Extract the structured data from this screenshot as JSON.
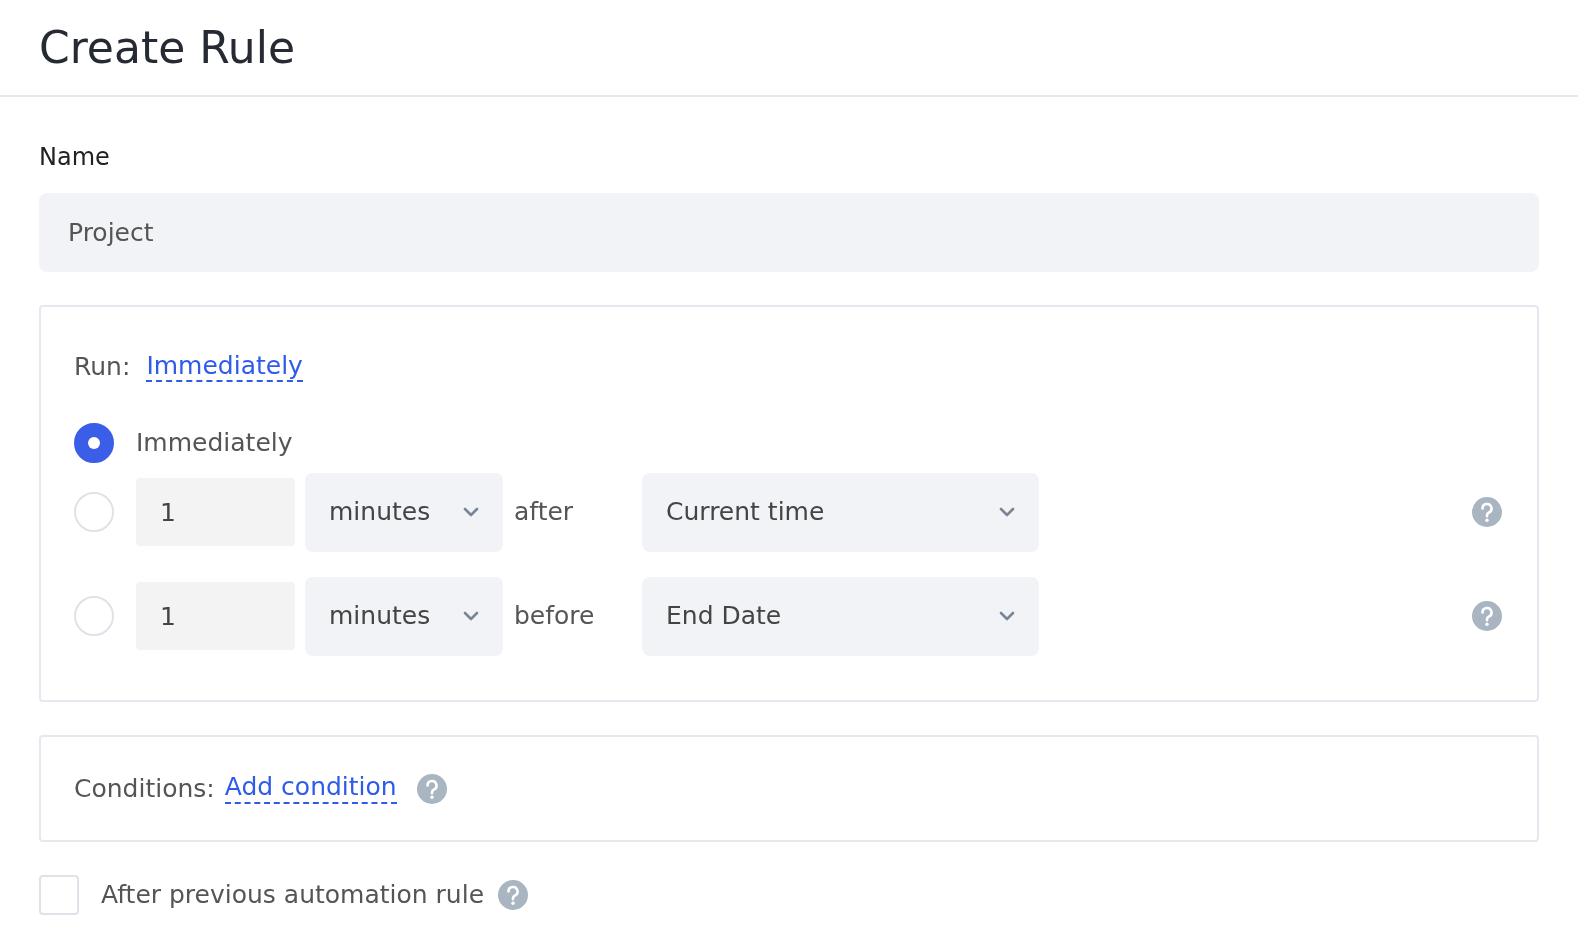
{
  "title": "Create Rule",
  "name_field": {
    "label": "Name",
    "value": "Project"
  },
  "run": {
    "label": "Run:",
    "link": "Immediately",
    "options": [
      {
        "kind": "plain",
        "selected": true,
        "label": "Immediately"
      },
      {
        "kind": "offset",
        "selected": false,
        "amount": "1",
        "unit": "minutes",
        "relation": "after",
        "reference": "Current time"
      },
      {
        "kind": "offset",
        "selected": false,
        "amount": "1",
        "unit": "minutes",
        "relation": "before",
        "reference": "End Date"
      }
    ]
  },
  "conditions": {
    "label": "Conditions:",
    "link": "Add condition"
  },
  "after_previous": {
    "label": "After previous automation rule",
    "checked": false
  }
}
